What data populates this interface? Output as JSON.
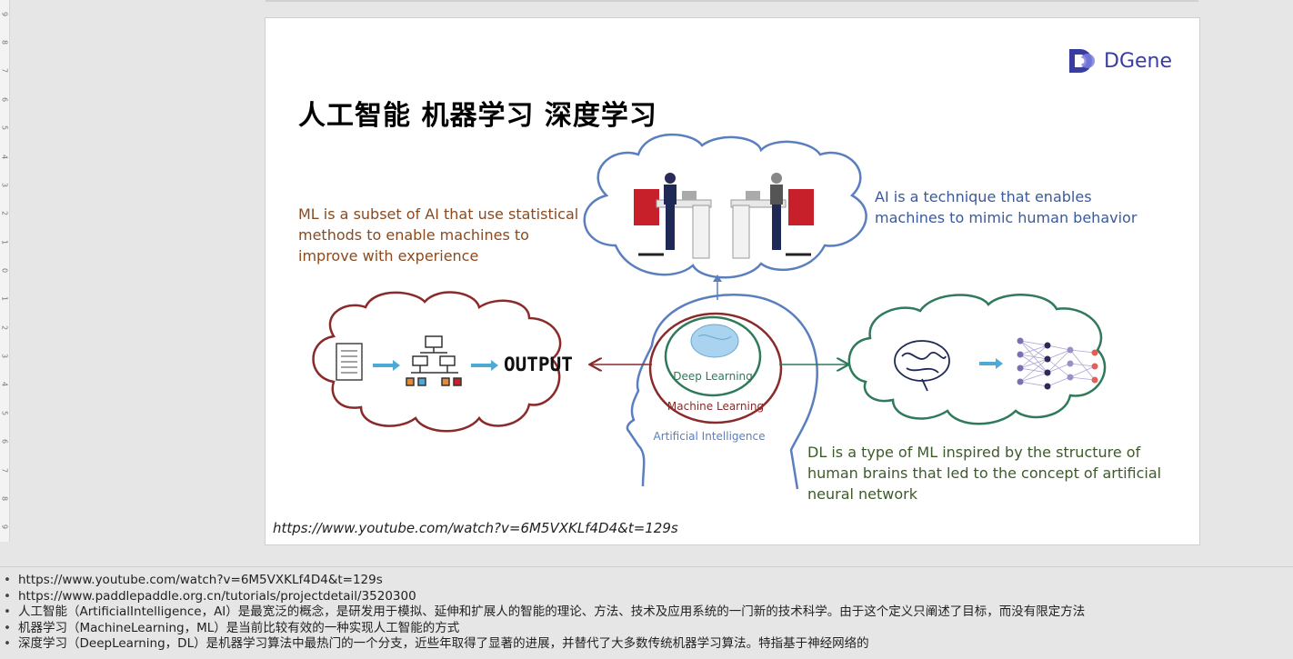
{
  "ruler": {
    "numbers": [
      "9",
      "8",
      "7",
      "6",
      "5",
      "4",
      "3",
      "2",
      "1",
      "0",
      "1",
      "2",
      "3",
      "4",
      "5",
      "6",
      "7",
      "8",
      "9"
    ]
  },
  "slide": {
    "title": "人工智能 机器学习 深度学习",
    "logo_text": "DGene",
    "ml_text": "ML is a subset of AI that use statistical methods to enable machines to improve with experience",
    "ai_text": "AI is a technique that enables machines to mimic human behavior",
    "dl_text": "DL is a type of ML inspired by the structure of human brains that led to the concept of artificial neural network",
    "source_url": "https://www.youtube.com/watch?v=6M5VXKLf4D4&t=129s",
    "diagram": {
      "output_label": "OUTPUT",
      "deep_learning_label": "Deep Learning",
      "machine_learning_label": "Machine Learning",
      "ai_label": "Artificial Intelligence"
    },
    "colors": {
      "ml": "#8a2a2a",
      "ai": "#5a7fbf",
      "dl": "#2f7a5a",
      "arrow": "#4fa9d6",
      "logo": "#3a3da0"
    }
  },
  "notes": {
    "items": [
      "https://www.youtube.com/watch?v=6M5VXKLf4D4&t=129s",
      "https://www.paddlepaddle.org.cn/tutorials/projectdetail/3520300",
      "人工智能（ArtificialIntelligence，AI）是最宽泛的概念，是研发用于模拟、延伸和扩展人的智能的理论、方法、技术及应用系统的一门新的技术科学。由于这个定义只阐述了目标，而没有限定方法",
      "机器学习（MachineLearning，ML）是当前比较有效的一种实现人工智能的方式",
      "深度学习（DeepLearning，DL）是机器学习算法中最热门的一个分支，近些年取得了显著的进展，并替代了大多数传统机器学习算法。特指基于神经网络的"
    ]
  }
}
